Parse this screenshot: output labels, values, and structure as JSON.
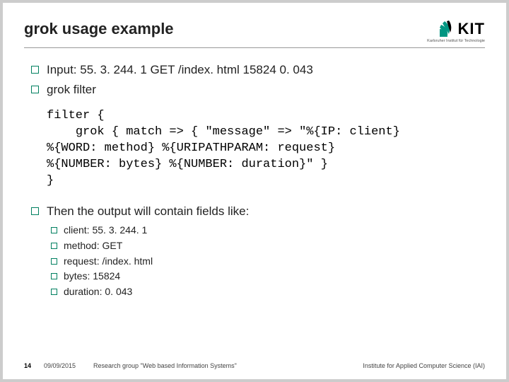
{
  "header": {
    "title": "grok usage example",
    "logo_text": "KIT",
    "logo_sub": "Karlsruher Institut für Technologie"
  },
  "bullets": {
    "input": "Input: 55. 3. 244. 1 GET /index. html 15824 0. 043",
    "filter_label": "grok filter",
    "output_intro": "Then the output will contain fields like:"
  },
  "code": "filter {\n    grok { match => { \"message\" => \"%{IP: client}\n%{WORD: method} %{URIPATHPARAM: request}\n%{NUMBER: bytes} %{NUMBER: duration}\" }\n}",
  "fields": {
    "client": "client: 55. 3. 244. 1",
    "method": "method: GET",
    "request": "request: /index. html",
    "bytes": "bytes: 15824",
    "duration": "duration: 0. 043"
  },
  "footer": {
    "page": "14",
    "date": "09/09/2015",
    "group": "Research group \"Web based Information Systems\"",
    "institute": "Institute for Applied Computer Science (IAI)"
  }
}
